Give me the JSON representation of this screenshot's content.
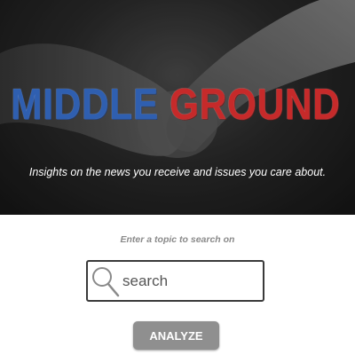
{
  "hero": {
    "title_left": "MIDDLE",
    "title_right": "GROUND",
    "tagline": "Insights on the news you receive and issues you care about."
  },
  "search": {
    "prompt": "Enter a topic to search on",
    "placeholder": "search",
    "icon": "search-icon"
  },
  "actions": {
    "analyze_label": "ANALYZE"
  },
  "colors": {
    "title_left": "#2f5fb0",
    "title_right": "#c62a2a",
    "button": "#8f8f8f",
    "hero_background": "#1e1e1e"
  }
}
